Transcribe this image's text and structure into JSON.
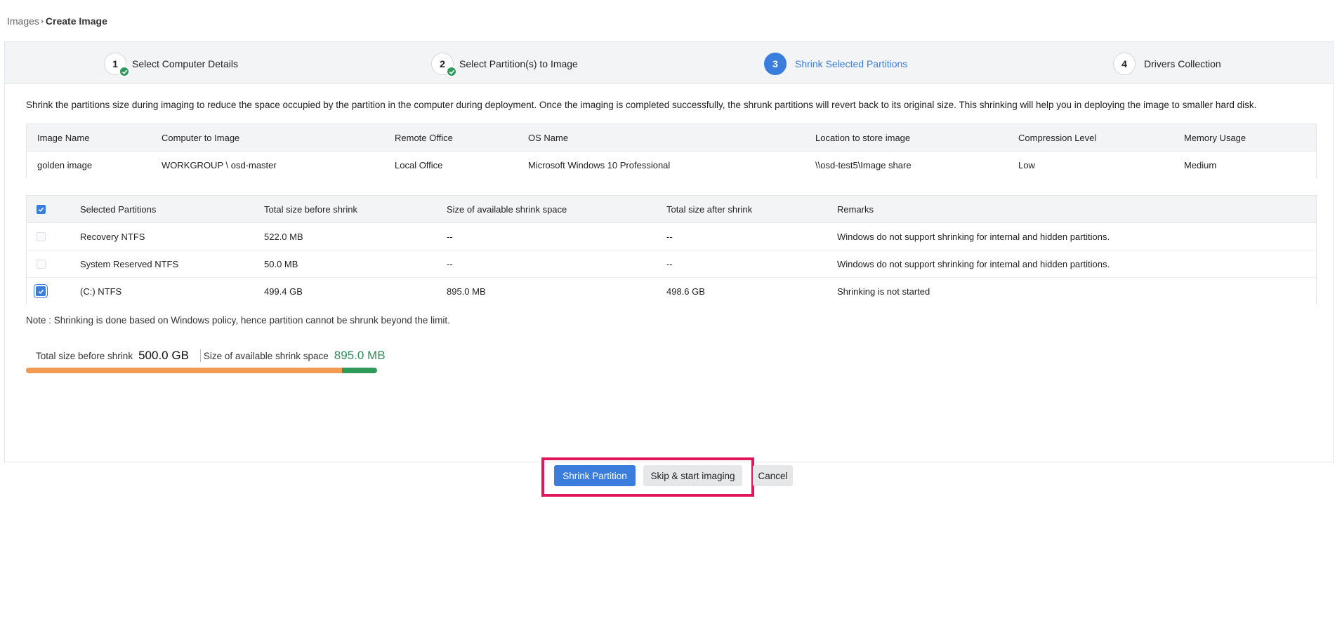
{
  "breadcrumb": {
    "root": "Images",
    "current": "Create Image"
  },
  "steps": [
    {
      "number": "1",
      "label": "Select Computer Details",
      "state": "completed"
    },
    {
      "number": "2",
      "label": "Select Partition(s) to Image",
      "state": "completed"
    },
    {
      "number": "3",
      "label": "Shrink Selected Partitions",
      "state": "active"
    },
    {
      "number": "4",
      "label": "Drivers Collection",
      "state": "pending"
    }
  ],
  "description": "Shrink the partitions size during imaging to reduce the space occupied by the partition in the computer during deployment. Once the imaging is completed successfully, the shrunk partitions will revert back to its original size. This shrinking will help you in deploying the image to smaller hard disk.",
  "info_table": {
    "headers": [
      "Image Name",
      "Computer to Image",
      "Remote Office",
      "OS Name",
      "Location to store image",
      "Compression Level",
      "Memory Usage"
    ],
    "row": [
      "golden image",
      "WORKGROUP \\ osd-master",
      "Local Office",
      "Microsoft Windows 10 Professional",
      "\\\\osd-test5\\Image share",
      "Low",
      "Medium"
    ]
  },
  "partition_table": {
    "headers": [
      "Selected Partitions",
      "Total size before shrink",
      "Size of available shrink space",
      "Total size after shrink",
      "Remarks"
    ],
    "select_all_checked": true,
    "rows": [
      {
        "checked": false,
        "disabled": true,
        "name": "Recovery NTFS",
        "before": "522.0 MB",
        "available": "--",
        "after": "--",
        "remarks": "Windows do not support shrinking for internal and hidden partitions."
      },
      {
        "checked": false,
        "disabled": true,
        "name": "System Reserved NTFS",
        "before": "50.0 MB",
        "available": "--",
        "after": "--",
        "remarks": "Windows do not support shrinking for internal and hidden partitions."
      },
      {
        "checked": true,
        "disabled": false,
        "name": "(C:) NTFS",
        "before": "499.4 GB",
        "available": "895.0 MB",
        "after": "498.6 GB",
        "remarks": "Shrinking is not started"
      }
    ]
  },
  "note": "Note : Shrinking is done based on Windows policy, hence partition cannot be shrunk beyond the limit.",
  "summary": {
    "before_label": "Total size before shrink",
    "before_value": "500.0 GB",
    "available_label": "Size of available shrink space",
    "available_value": "895.0 MB",
    "bar_used_fraction": 0.9,
    "bar_shrink_fraction": 0.1
  },
  "buttons": {
    "shrink": "Shrink Partition",
    "skip": "Skip & start imaging",
    "cancel": "Cancel"
  },
  "colors": {
    "primary": "#3b7ddd",
    "success": "#2e9b5c",
    "orange": "#f39a52",
    "highlight": "#e0175a"
  }
}
